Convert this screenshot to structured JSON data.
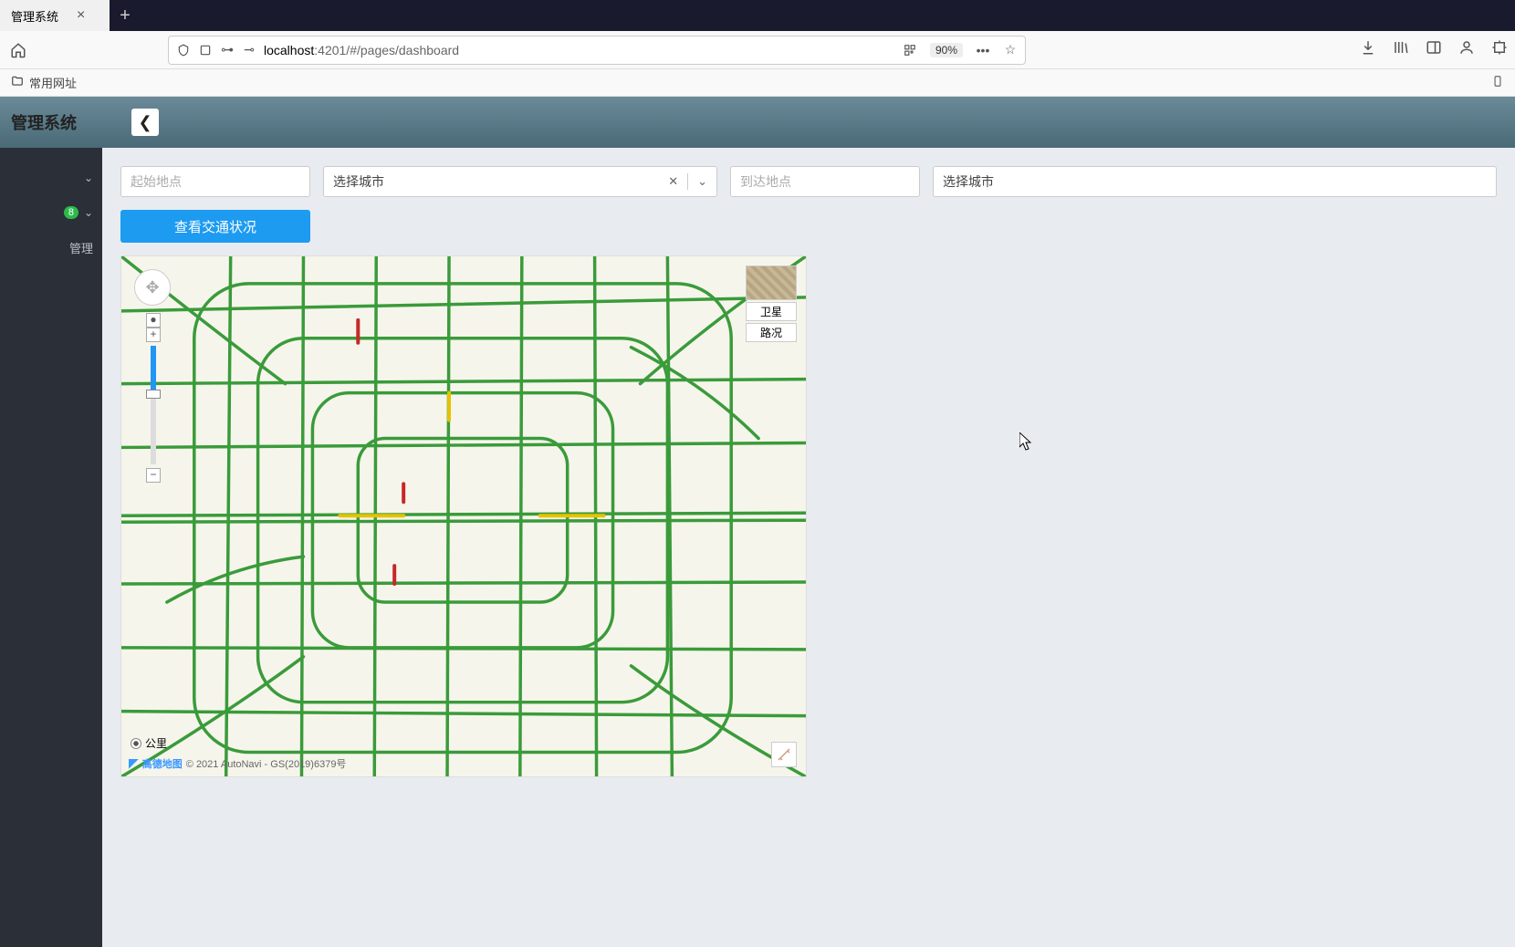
{
  "browser": {
    "tab_title": "管理系统",
    "url_host": "localhost",
    "url_port_path": ":4201/#/pages/dashboard",
    "zoom": "90%",
    "bookmarks": {
      "folder": "常用网址"
    }
  },
  "app": {
    "header_title": "管理系统",
    "sidebar": {
      "badge": "8",
      "item_management": "管理"
    }
  },
  "form": {
    "start_placeholder": "起始地点",
    "start_city_label": "选择城市",
    "dest_placeholder": "到达地点",
    "dest_city_label": "选择城市",
    "action_button": "查看交通状况"
  },
  "map": {
    "layer_satellite": "卫星",
    "layer_traffic": "路况",
    "toggle_public": "公里",
    "credit_brand": "高德地图",
    "credit_copy": "© 2021 AutoNavi - GS(2019)6379号"
  }
}
